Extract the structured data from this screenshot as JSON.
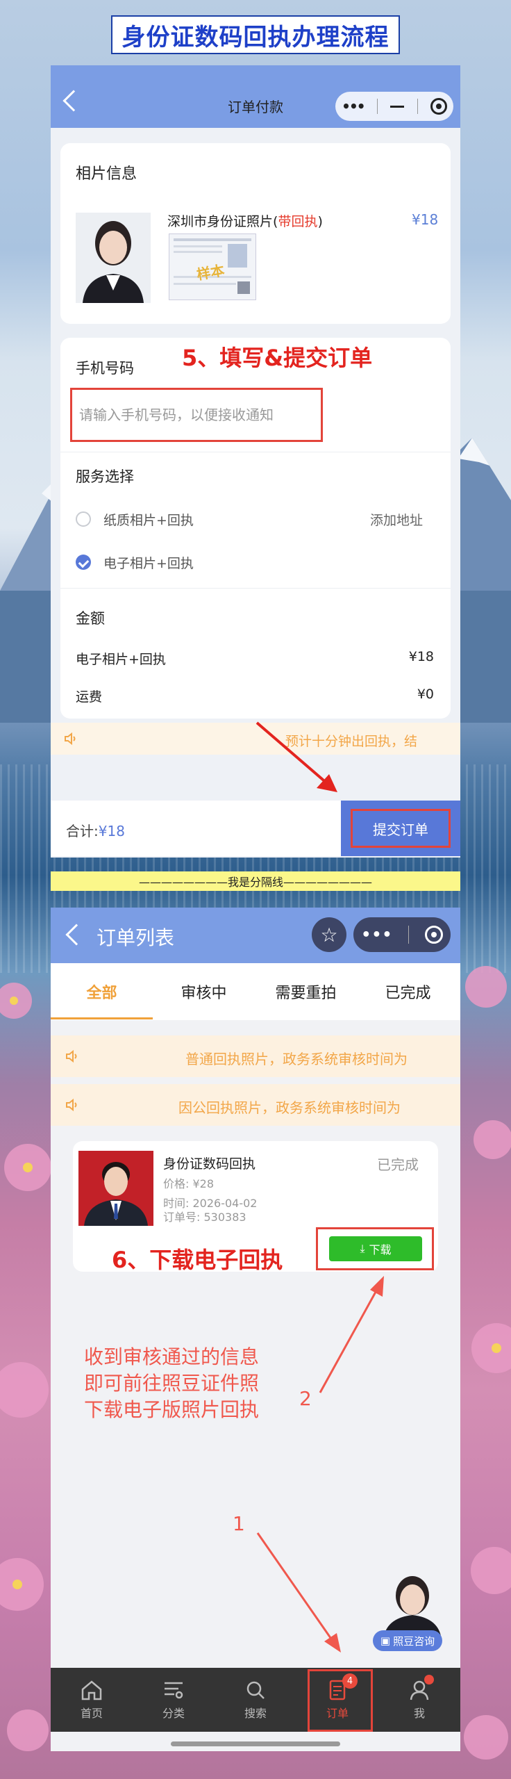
{
  "banner": {
    "title": "身份证数码回执办理流程"
  },
  "checkout": {
    "header_title": "订单付款",
    "photo_section_title": "相片信息",
    "product_name": "深圳市身份证照片",
    "product_tag_prefix": "(",
    "product_tag": "带回执",
    "product_tag_suffix": ")",
    "product_price": "¥18",
    "sample_label": "样本",
    "phone_label": "手机号码",
    "phone_placeholder": "请输入手机号码，以便接收通知",
    "service_label": "服务选择",
    "options": [
      {
        "label": "纸质相片+回执",
        "selected": false
      },
      {
        "label": "电子相片+回执",
        "selected": true
      }
    ],
    "add_address": "添加地址",
    "amount_label": "金额",
    "lines": [
      {
        "label": "电子相片+回执",
        "value": "¥18"
      },
      {
        "label": "运费",
        "value": "¥0"
      }
    ],
    "notice": "预计十分钟出回执，结",
    "total_label": "合计:",
    "total_value": "¥18",
    "submit_label": "提交订单",
    "callout": "5、填写&提交订单"
  },
  "separator": "————————我是分隔线————————",
  "orders": {
    "header_title": "订单列表",
    "tabs": [
      "全部",
      "审核中",
      "需要重拍",
      "已完成"
    ],
    "active_tab": 0,
    "notices": [
      "普通回执照片，政务系统审核时间为",
      "因公回执照片，政务系统审核时间为"
    ],
    "order": {
      "name": "身份证数码回执",
      "status": "已完成",
      "price": "价格: ¥28",
      "time": "时间: 2026-04-02",
      "number": "订单号: 530383",
      "download_label": "下载"
    },
    "callout": "6、下载电子回执",
    "note_lines": [
      "收到审核通过的信息",
      "即可前往照豆证件照",
      "下载电子版照片回执"
    ],
    "step_2": "2",
    "step_1": "1",
    "consult_label": "照豆咨询",
    "tabbar": [
      {
        "label": "首页",
        "icon": "home-icon"
      },
      {
        "label": "分类",
        "icon": "category-icon"
      },
      {
        "label": "搜索",
        "icon": "search-icon"
      },
      {
        "label": "订单",
        "icon": "order-icon",
        "badge": "4"
      },
      {
        "label": "我",
        "icon": "user-icon"
      }
    ]
  },
  "colors": {
    "accent_blue": "#5878d8",
    "header_blue": "#7b9de4",
    "annotation_red": "#e3241f",
    "notice_orange": "#f2a648",
    "download_green": "#2ebc2a"
  }
}
